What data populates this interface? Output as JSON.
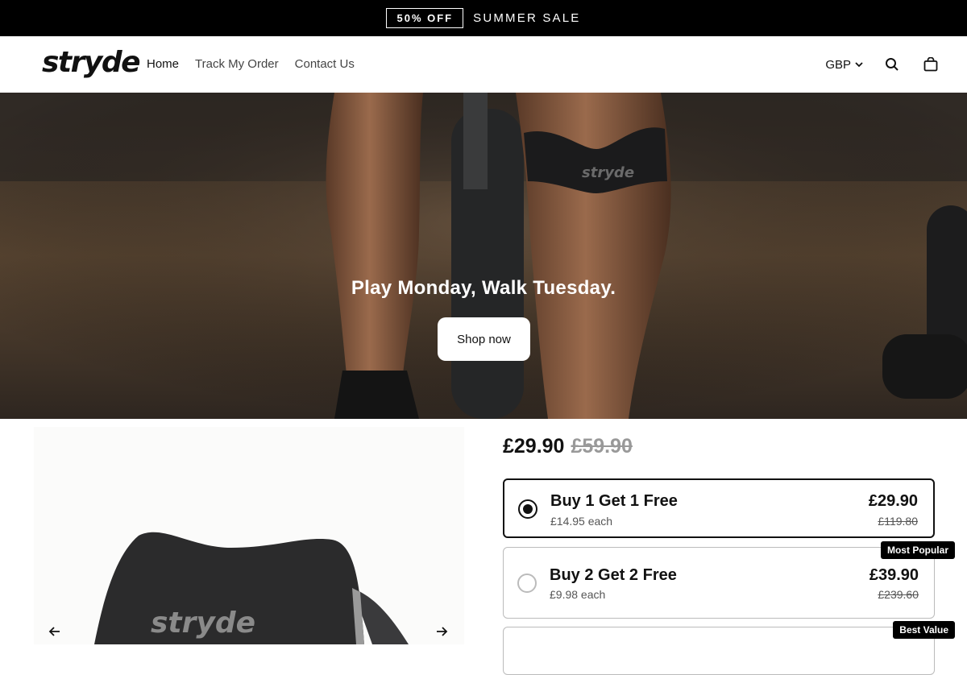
{
  "announcement": {
    "badge": "50% OFF",
    "message": "SUMMER SALE"
  },
  "header": {
    "logo": "stryde",
    "nav": [
      {
        "label": "Home",
        "active": true
      },
      {
        "label": "Track My Order",
        "active": false
      },
      {
        "label": "Contact Us",
        "active": false
      }
    ],
    "currency": "GBP",
    "icons": [
      "chevron-down-icon",
      "search-icon",
      "shopping-bag-icon"
    ]
  },
  "hero": {
    "headline": "Play Monday, Walk Tuesday.",
    "cta": "Shop now",
    "strap_text": "stryde"
  },
  "product": {
    "image_brand_text": "stryde",
    "price": "£29.90",
    "compare_price": "£59.90",
    "options": [
      {
        "title": "Buy 1 Get 1 Free",
        "each": "£14.95 each",
        "price": "£29.90",
        "compare": "£119.80",
        "selected": true,
        "tag": ""
      },
      {
        "title": "Buy 2 Get 2 Free",
        "each": "£9.98 each",
        "price": "£39.90",
        "compare": "£239.60",
        "selected": false,
        "tag": "Most Popular"
      },
      {
        "title": "",
        "each": "",
        "price": "",
        "compare": "",
        "selected": false,
        "tag": "Best Value"
      }
    ]
  },
  "colors": {
    "announcement_bg": "#000000",
    "text": "#111111",
    "muted": "#999999",
    "border": "#bbbbbb"
  }
}
